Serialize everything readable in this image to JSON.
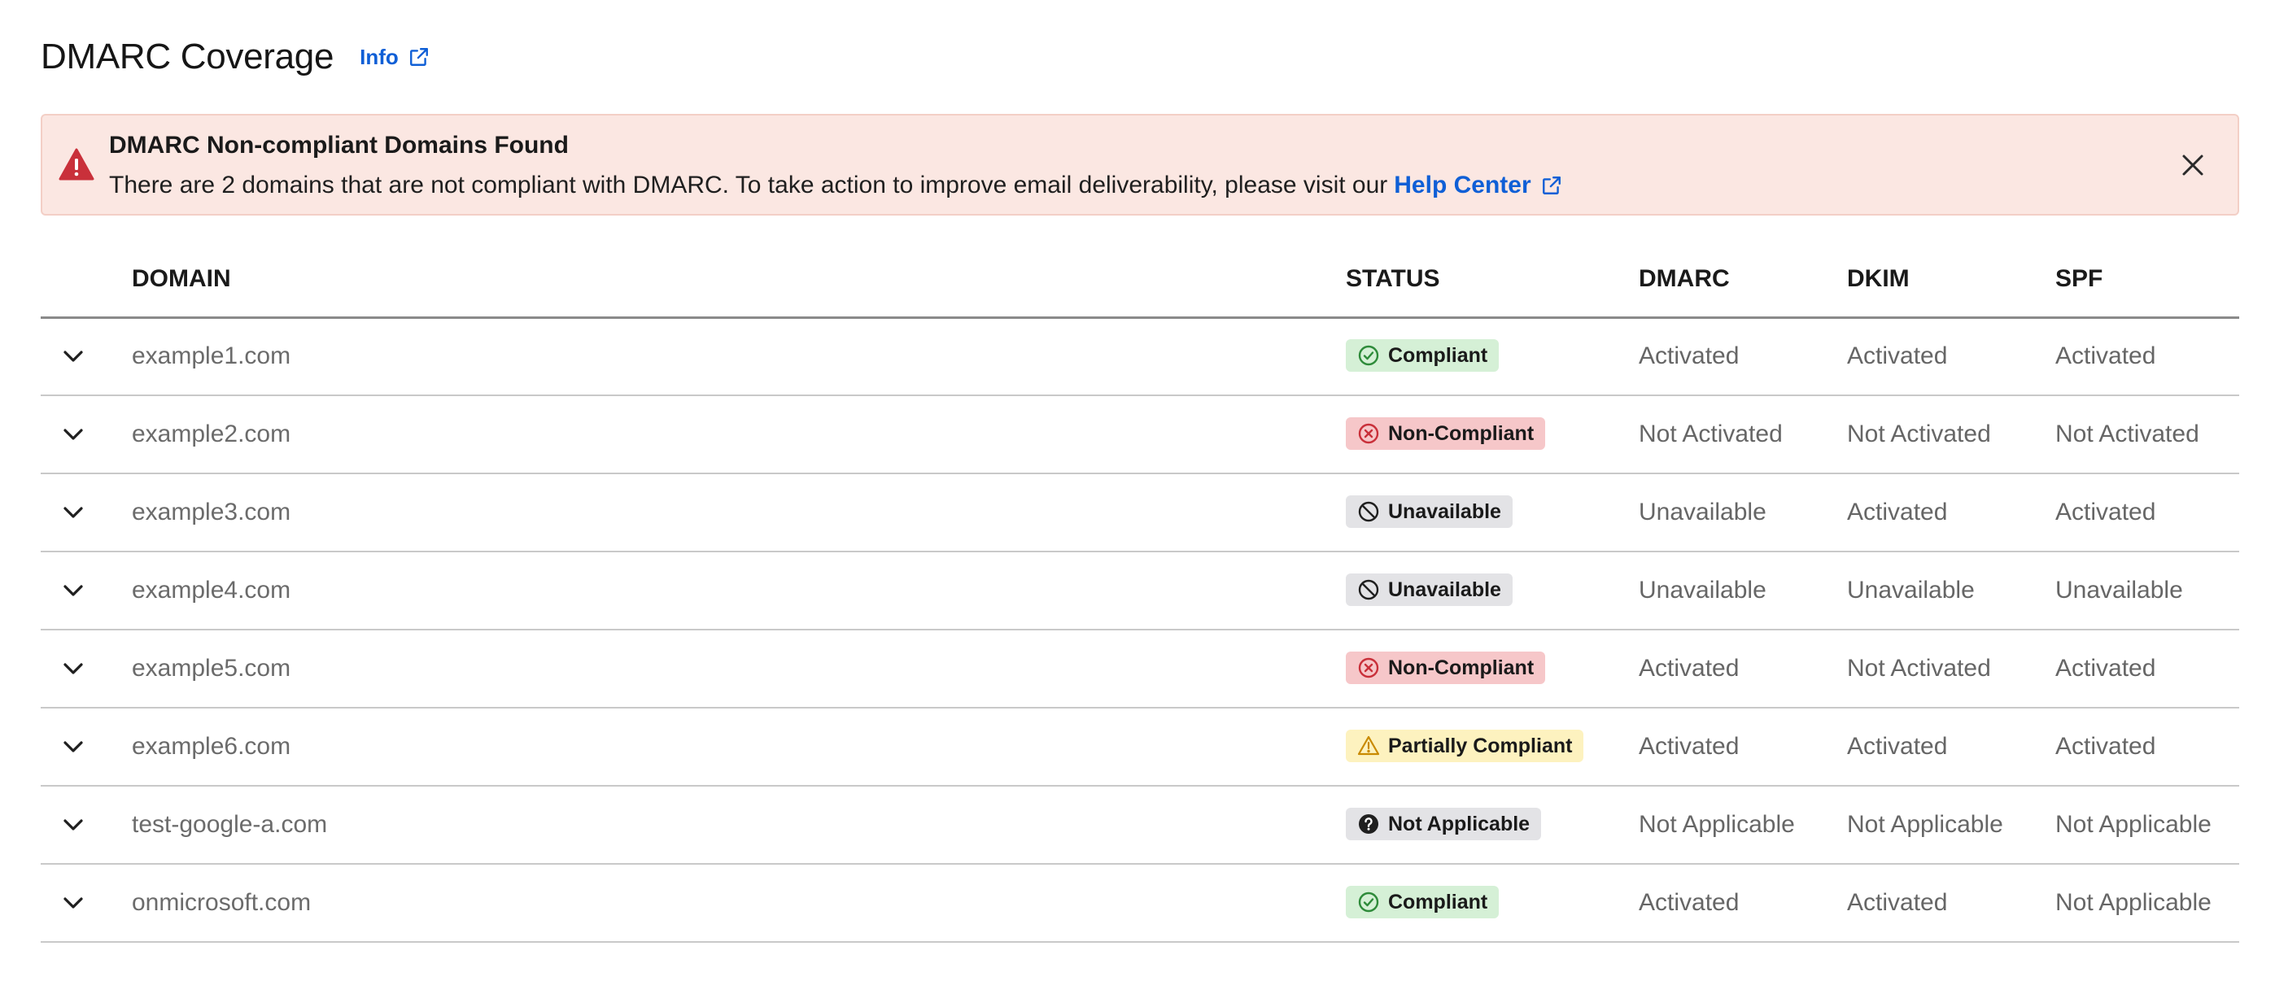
{
  "header": {
    "title": "DMARC Coverage",
    "info_label": "Info"
  },
  "alert": {
    "title": "DMARC Non-compliant Domains Found",
    "body": "There are 2 domains that are not compliant with DMARC. To take action to improve email deliverability, please visit our",
    "link_label": "Help Center"
  },
  "table": {
    "columns": [
      "DOMAIN",
      "STATUS",
      "DMARC",
      "DKIM",
      "SPF"
    ],
    "rows": [
      {
        "domain": "example1.com",
        "status": "Compliant",
        "status_kind": "compliant",
        "dmarc": "Activated",
        "dkim": "Activated",
        "spf": "Activated"
      },
      {
        "domain": "example2.com",
        "status": "Non-Compliant",
        "status_kind": "noncompliant",
        "dmarc": "Not Activated",
        "dkim": "Not Activated",
        "spf": "Not Activated"
      },
      {
        "domain": "example3.com",
        "status": "Unavailable",
        "status_kind": "unavailable",
        "dmarc": "Unavailable",
        "dkim": "Activated",
        "spf": "Activated"
      },
      {
        "domain": "example4.com",
        "status": "Unavailable",
        "status_kind": "unavailable",
        "dmarc": "Unavailable",
        "dkim": "Unavailable",
        "spf": "Unavailable"
      },
      {
        "domain": "example5.com",
        "status": "Non-Compliant",
        "status_kind": "noncompliant",
        "dmarc": "Activated",
        "dkim": "Not Activated",
        "spf": "Activated"
      },
      {
        "domain": "example6.com",
        "status": "Partially Compliant",
        "status_kind": "partial",
        "dmarc": "Activated",
        "dkim": "Activated",
        "spf": "Activated"
      },
      {
        "domain": "test-google-a.com",
        "status": "Not Applicable",
        "status_kind": "na",
        "dmarc": "Not Applicable",
        "dkim": "Not Applicable",
        "spf": "Not Applicable"
      },
      {
        "domain": "onmicrosoft.com",
        "status": "Compliant",
        "status_kind": "compliant",
        "dmarc": "Activated",
        "dkim": "Activated",
        "spf": "Not Applicable"
      }
    ]
  },
  "colors": {
    "link": "#0f5fd6",
    "alert_bg": "#fbe7e2",
    "danger": "#c9303a",
    "success": "#2e8b3a",
    "warning": "#c98a00"
  },
  "icons": {
    "info_link": "external-link-icon",
    "alert": "warning-triangle-icon",
    "close": "close-icon",
    "row_expand": "chevron-down-icon",
    "compliant": "check-circle-icon",
    "noncompliant": "x-circle-icon",
    "unavailable": "no-entry-icon",
    "partial": "warning-triangle-outline-icon",
    "na": "question-circle-icon"
  }
}
